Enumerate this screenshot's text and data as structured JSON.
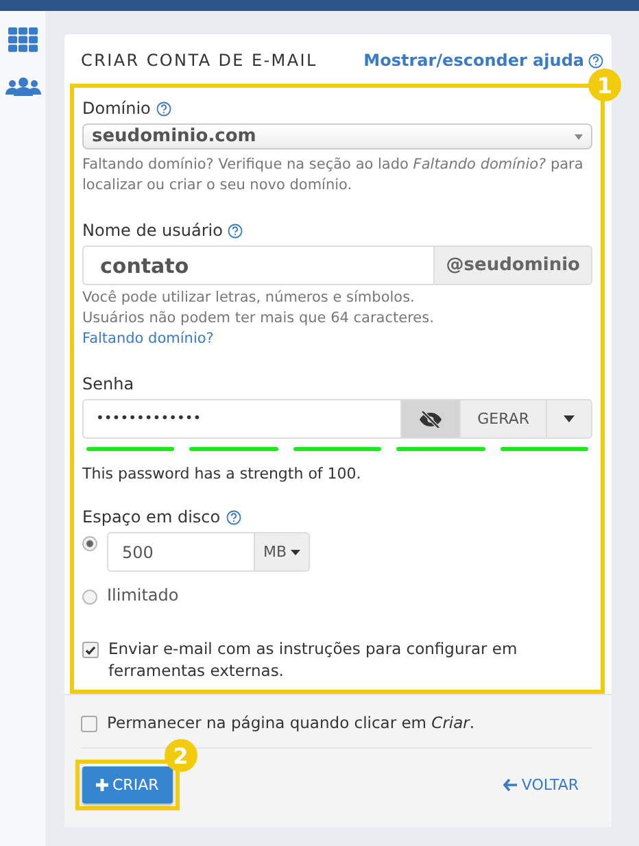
{
  "sidebar": {
    "items": [
      {
        "kind": "apps"
      },
      {
        "kind": "users"
      }
    ]
  },
  "card": {
    "title": "CRIAR CONTA DE E-MAIL",
    "help_link": "Mostrar/esconder ajuda"
  },
  "callouts": [
    "1",
    "2"
  ],
  "domain": {
    "label": "Domínio",
    "value": "seudominio.com",
    "hint": "Faltando domínio? Verifique na seção ao lado *Faltando domínio?* para localizar ou criar o seu novo domínio."
  },
  "username": {
    "label": "Nome de usuário",
    "value": "contato",
    "suffix": "@seudominio",
    "hints": [
      "Você pode utilizar letras, números e símbolos.",
      "Usuários não podem ter mais que 64 caracteres."
    ],
    "link": "Faltando domínio?"
  },
  "password": {
    "label": "Senha",
    "value": "•••••••••••••",
    "generate": "GERAR",
    "strength_text": "This password has a strength of 100."
  },
  "disk": {
    "label": "Espaço em disco",
    "options": [
      {
        "kind": "amount",
        "value": "500",
        "unit": "MB",
        "selected": true
      },
      {
        "kind": "text",
        "label": "Ilimitado",
        "selected": false
      }
    ]
  },
  "send_email": {
    "label": "Enviar e-mail com as instruções para configurar em ferramentas externas.",
    "checked": true
  },
  "stay_on_page": {
    "label": "Permanecer na página quando clicar em *Criar*.",
    "checked": false
  },
  "create_button": "CRIAR",
  "back_link": "VOLTAR"
}
